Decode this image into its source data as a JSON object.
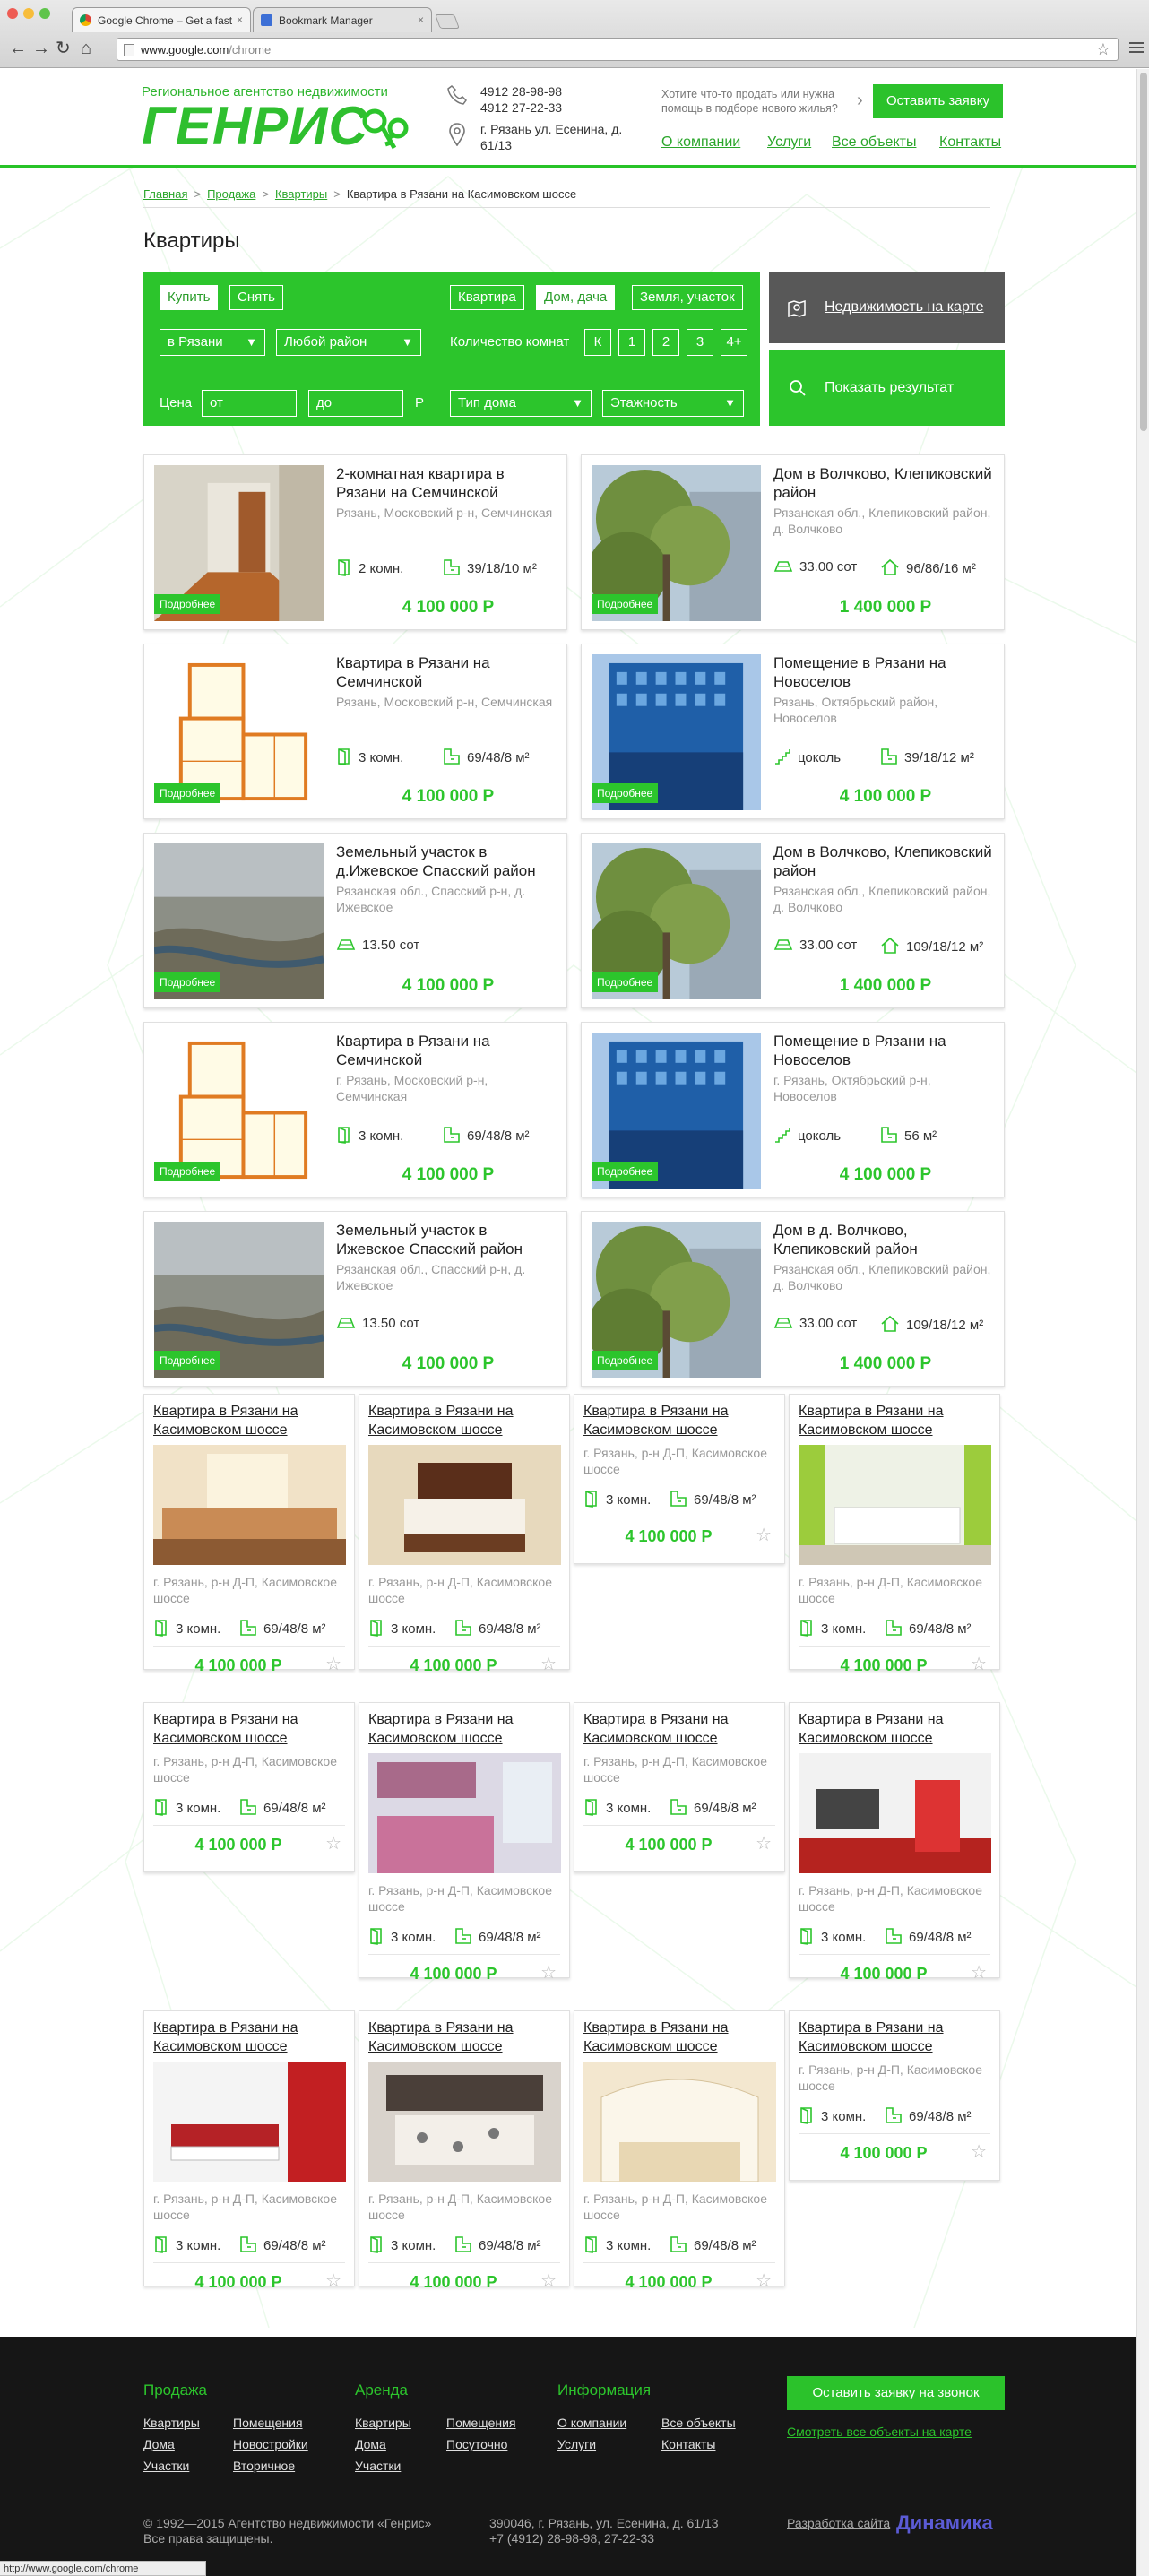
{
  "browser": {
    "tabs": [
      {
        "title": "Google Chrome – Get a fast",
        "active": true
      },
      {
        "title": "Bookmark Manager",
        "active": false
      }
    ],
    "url_host": "www.google.com",
    "url_path": "/chrome",
    "status_url": "http://www.google.com/chrome"
  },
  "header": {
    "tagline": "Региональное агентство недвижимости",
    "logo": "ГЕНРИС",
    "phone1": "4912 28-98-98",
    "phone2": "4912 27-22-33",
    "address": "г. Рязань ул. Есенина, д. 61/13",
    "prompt": "Хотите что-то продать или нужна помощь в подборе нового жилья?",
    "request_button": "Оставить заявку",
    "nav": [
      "О компании",
      "Услуги",
      "Все объекты",
      "Контакты"
    ]
  },
  "breadcrumbs": [
    "Главная",
    "Продажа",
    "Квартиры",
    "Квартира в Рязани на Касимовском шоссе"
  ],
  "page_title": "Квартиры",
  "filter": {
    "buy": "Купить",
    "rent": "Снять",
    "type_flat": "Квартира",
    "type_house": "Дом, дача",
    "type_land": "Земля, участок",
    "city": "в Рязани",
    "district": "Любой район",
    "rooms_label": "Количество комнат",
    "rooms": [
      "К",
      "1",
      "2",
      "3",
      "4+"
    ],
    "price_label": "Цена",
    "price_from": "от",
    "price_to": "до",
    "currency": "Р",
    "house_type": "Тип дома",
    "floors": "Этажность",
    "map_button": "Недвижимость на карте",
    "search_button": "Показать результат"
  },
  "cards_more_label": "Подробнее",
  "cards": [
    {
      "title": "2-комнатная квартира в Рязани на Семчинской",
      "addr": "Рязань, Московский р-н, Семчинская",
      "f1": "2 комн.",
      "f2": "39/18/10 м²",
      "price": "4 100 000 Р",
      "img": "room",
      "f1icon": "door",
      "f2icon": "plan"
    },
    {
      "title": "Дом в Волчково, Клепиковский район",
      "addr": "Рязанская обл., Клепиковский район, д. Волчково",
      "f1": "33.00 сот",
      "f2": "96/86/16 м²",
      "price": "1 400 000 Р",
      "img": "tree",
      "f1icon": "land",
      "f2icon": "house"
    },
    {
      "title": "Квартира в Рязани на Семчинской",
      "addr": "Рязань, Московский р-н, Семчинская",
      "f1": "3 комн.",
      "f2": "69/48/8 м²",
      "price": "4 100 000 Р",
      "img": "floorplan",
      "f1icon": "door",
      "f2icon": "plan"
    },
    {
      "title": "Помещение в Рязани на Новоселов",
      "addr": "Рязань, Октябрьский район, Новоселов",
      "f1": "цоколь",
      "f2": "39/18/12 м²",
      "price": "4 100 000 Р",
      "img": "building",
      "f1icon": "stairs",
      "f2icon": "plan"
    },
    {
      "title": "Земельный участок в д.Ижевское Спасский район",
      "addr": "Рязанская обл., Спасский р-н, д. Ижевское",
      "f1": "13.50 сот",
      "f2": "",
      "price": "4 100 000 Р",
      "img": "aerial",
      "f1icon": "land",
      "f2icon": ""
    },
    {
      "title": "Дом в Волчково, Клепиковский район",
      "addr": "Рязанская обл., Клепиковский район, д. Волчково",
      "f1": "33.00 сот",
      "f2": "109/18/12 м²",
      "price": "1 400 000 Р",
      "img": "tree",
      "f1icon": "land",
      "f2icon": "house"
    },
    {
      "title": "Квартира в Рязани на Семчинской",
      "addr": "г. Рязань, Московский р-н, Семчинская",
      "f1": "3 комн.",
      "f2": "69/48/8 м²",
      "price": "4 100 000 Р",
      "img": "floorplan",
      "f1icon": "door",
      "f2icon": "plan"
    },
    {
      "title": "Помещение в Рязани на Новоселов",
      "addr": "г. Рязань, Октябрьский р-н, Новоселов",
      "f1": "цоколь",
      "f2": "56 м²",
      "price": "4 100 000 Р",
      "img": "building",
      "f1icon": "stairs",
      "f2icon": "plan"
    },
    {
      "title": "Земельный участок в Ижевское Спасский район",
      "addr": "Рязанская обл., Спасский р-н, д. Ижевское",
      "f1": "13.50 сот",
      "f2": "",
      "price": "4 100 000 Р",
      "img": "aerial",
      "f1icon": "land",
      "f2icon": ""
    },
    {
      "title": "Дом в д. Волчково, Клепиковский район",
      "addr": "Рязанская обл., Клепиковский район, д. Волчково",
      "f1": "33.00 сот",
      "f2": "109/18/12 м²",
      "price": "1 400 000 Р",
      "img": "tree",
      "f1icon": "land",
      "f2icon": "house"
    }
  ],
  "tiles": {
    "title": "Квартира в Рязани на Касимовском шоссе",
    "addr": "г. Рязань, р-н Д-П, Касимовское шоссе",
    "f1": "3 комн.",
    "f2": "69/48/8 м²",
    "price": "4 100 000 Р",
    "images": [
      "livingroom",
      "bedroom",
      "",
      "white-sofa",
      "",
      "kitchen",
      "",
      "tv-room",
      "loft-bed",
      "bedroom2",
      "kitchen2",
      ""
    ]
  },
  "footer": {
    "sale_heading": "Продажа",
    "sale_links": [
      "Квартиры",
      "Помещения",
      "Дома",
      "Новостройки",
      "Участки",
      "Вторичное"
    ],
    "rent_heading": "Аренда",
    "rent_links": [
      "Квартиры",
      "Помещения",
      "Дома",
      "Посуточно",
      "Участки"
    ],
    "info_heading": "Информация",
    "info_links": [
      "О компании",
      "Все объекты",
      "Услуги",
      "Контакты"
    ],
    "callback_button": "Оставить заявку на звонок",
    "map_link": "Смотреть все объекты на карте",
    "copyright1": "© 1992—2015 Агентство недвижимости «Генрис»",
    "copyright2": "Все права защищены.",
    "address1": "390046, г. Рязань, ул. Есенина, д. 61/13",
    "address2": "+7 (4912) 28-98-98, 27-22-33",
    "dev_label": "Разработка сайта",
    "dev_name": "Динамика"
  }
}
